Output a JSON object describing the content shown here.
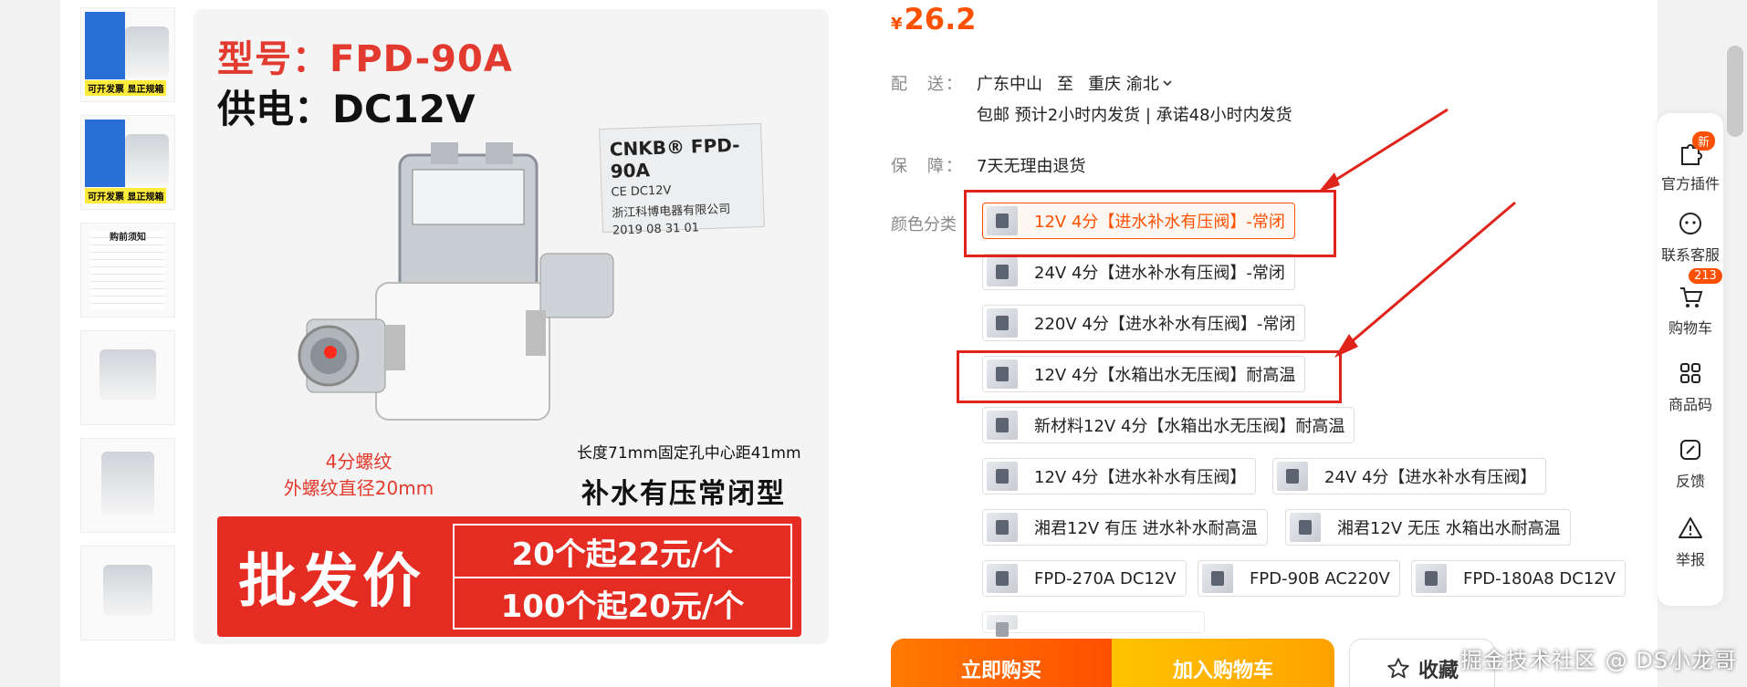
{
  "thumbnails": [
    {
      "badge": "可开发票 显正规箱"
    },
    {
      "badge": "可开发票 显正规箱"
    },
    {
      "title": "购前须知"
    },
    {},
    {},
    {}
  ],
  "main_image": {
    "model_label": "型号：FPD-90A",
    "power_label": "供电：DC12V",
    "card_brand": "CNKB® FPD-90A",
    "card_line1": "CE  DC12V",
    "card_line2": "浙江科博电器有限公司",
    "card_line3": "2019 08 31 01",
    "spec_thread_1": "4分螺纹",
    "spec_thread_2": "外螺纹直径20mm",
    "spec_length": "长度71mm固定孔中心距41mm",
    "valve_type": "补水有压常闭型",
    "wholesale_label": "批发价",
    "tier_1": "20个起22元/个",
    "tier_2": "100个起20元/个"
  },
  "price": {
    "currency": "¥",
    "value": "26.2"
  },
  "shipping": {
    "label": "配　送：",
    "origin": "广东中山",
    "to": "至",
    "destination": "重庆 渝北",
    "sub": "包邮  预计2小时内发货 | 承诺48小时内发货"
  },
  "guarantee": {
    "label": "保　障：",
    "value": "7天无理由退货"
  },
  "sku_label": "颜色分类",
  "skus": [
    "12V 4分【进水补水有压阀】-常闭",
    "24V 4分【进水补水有压阀】-常闭",
    "220V 4分【进水补水有压阀】-常闭",
    "12V 4分【水箱出水无压阀】耐高温",
    "新材料12V 4分【水箱出水无压阀】耐高温",
    "12V 4分【进水补水有压阀】",
    "24V 4分【进水补水有压阀】",
    "湘君12V 有压 进水补水耐高温",
    "湘君12V 无压 水箱出水耐高温",
    "FPD-270A DC12V",
    "FPD-90B AC220V",
    "FPD-180A8 DC12V"
  ],
  "buttons": {
    "buy": "立即购买",
    "cart": "加入购物车",
    "favorite": "收藏"
  },
  "sidebar": {
    "plugin": "官方插件",
    "plugin_badge": "新",
    "service": "联系客服",
    "cart": "购物车",
    "cart_badge": "213",
    "qrcode": "商品码",
    "feedback": "反馈",
    "report": "举报"
  },
  "watermark": "掘金技术社区 @ DS小龙哥",
  "colors": {
    "accent": "#ff5000",
    "annotation_red": "#e0241b"
  }
}
